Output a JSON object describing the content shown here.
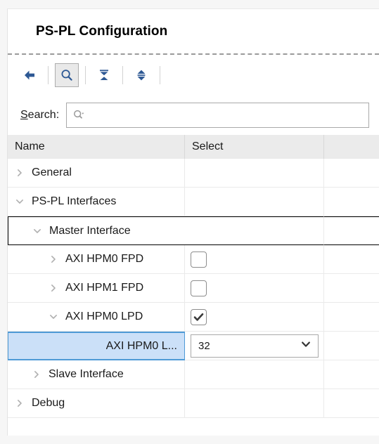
{
  "header": {
    "title": "PS-PL Configuration"
  },
  "toolbar": {
    "items": [
      {
        "name": "back-button",
        "icon": "back-arrow-icon",
        "pressed": false
      },
      {
        "name": "search-toggle",
        "icon": "search-icon",
        "pressed": true
      },
      {
        "name": "collapse-all-button",
        "icon": "collapse-all-icon",
        "pressed": false
      },
      {
        "name": "expand-all-button",
        "icon": "expand-all-icon",
        "pressed": false
      }
    ]
  },
  "search": {
    "label_prefix": "S",
    "label_rest": "earch:",
    "value": "",
    "placeholder": "",
    "icon": "search-dropdown-icon"
  },
  "table": {
    "columns": [
      "Name",
      "Select"
    ],
    "rows": [
      {
        "label": "General",
        "indent": 1,
        "twisty": "collapsed",
        "control": "none",
        "state": "normal"
      },
      {
        "label": "PS-PL Interfaces",
        "indent": 1,
        "twisty": "expanded",
        "control": "none",
        "state": "normal"
      },
      {
        "label": "Master Interface",
        "indent": 2,
        "twisty": "expanded",
        "control": "none",
        "state": "focused"
      },
      {
        "label": "AXI HPM0 FPD",
        "indent": 3,
        "twisty": "collapsed",
        "control": "checkbox",
        "checked": false,
        "state": "normal"
      },
      {
        "label": "AXI HPM1 FPD",
        "indent": 3,
        "twisty": "collapsed",
        "control": "checkbox",
        "checked": false,
        "state": "normal"
      },
      {
        "label": "AXI HPM0 LPD",
        "indent": 3,
        "twisty": "expanded",
        "control": "checkbox",
        "checked": true,
        "state": "normal"
      },
      {
        "label": "AXI HPM0 L...",
        "indent": 4,
        "twisty": "none",
        "control": "combo",
        "combo_value": "32",
        "state": "selected"
      },
      {
        "label": "Slave Interface",
        "indent": 2,
        "twisty": "collapsed",
        "control": "none",
        "state": "normal"
      },
      {
        "label": "Debug",
        "indent": 1,
        "twisty": "collapsed",
        "control": "none",
        "state": "normal"
      }
    ]
  },
  "colors": {
    "accent_blue": "#2d5894",
    "selection_bg": "#cbe0f8",
    "selection_border": "#4e9ad6",
    "header_bg": "#ebebeb"
  }
}
